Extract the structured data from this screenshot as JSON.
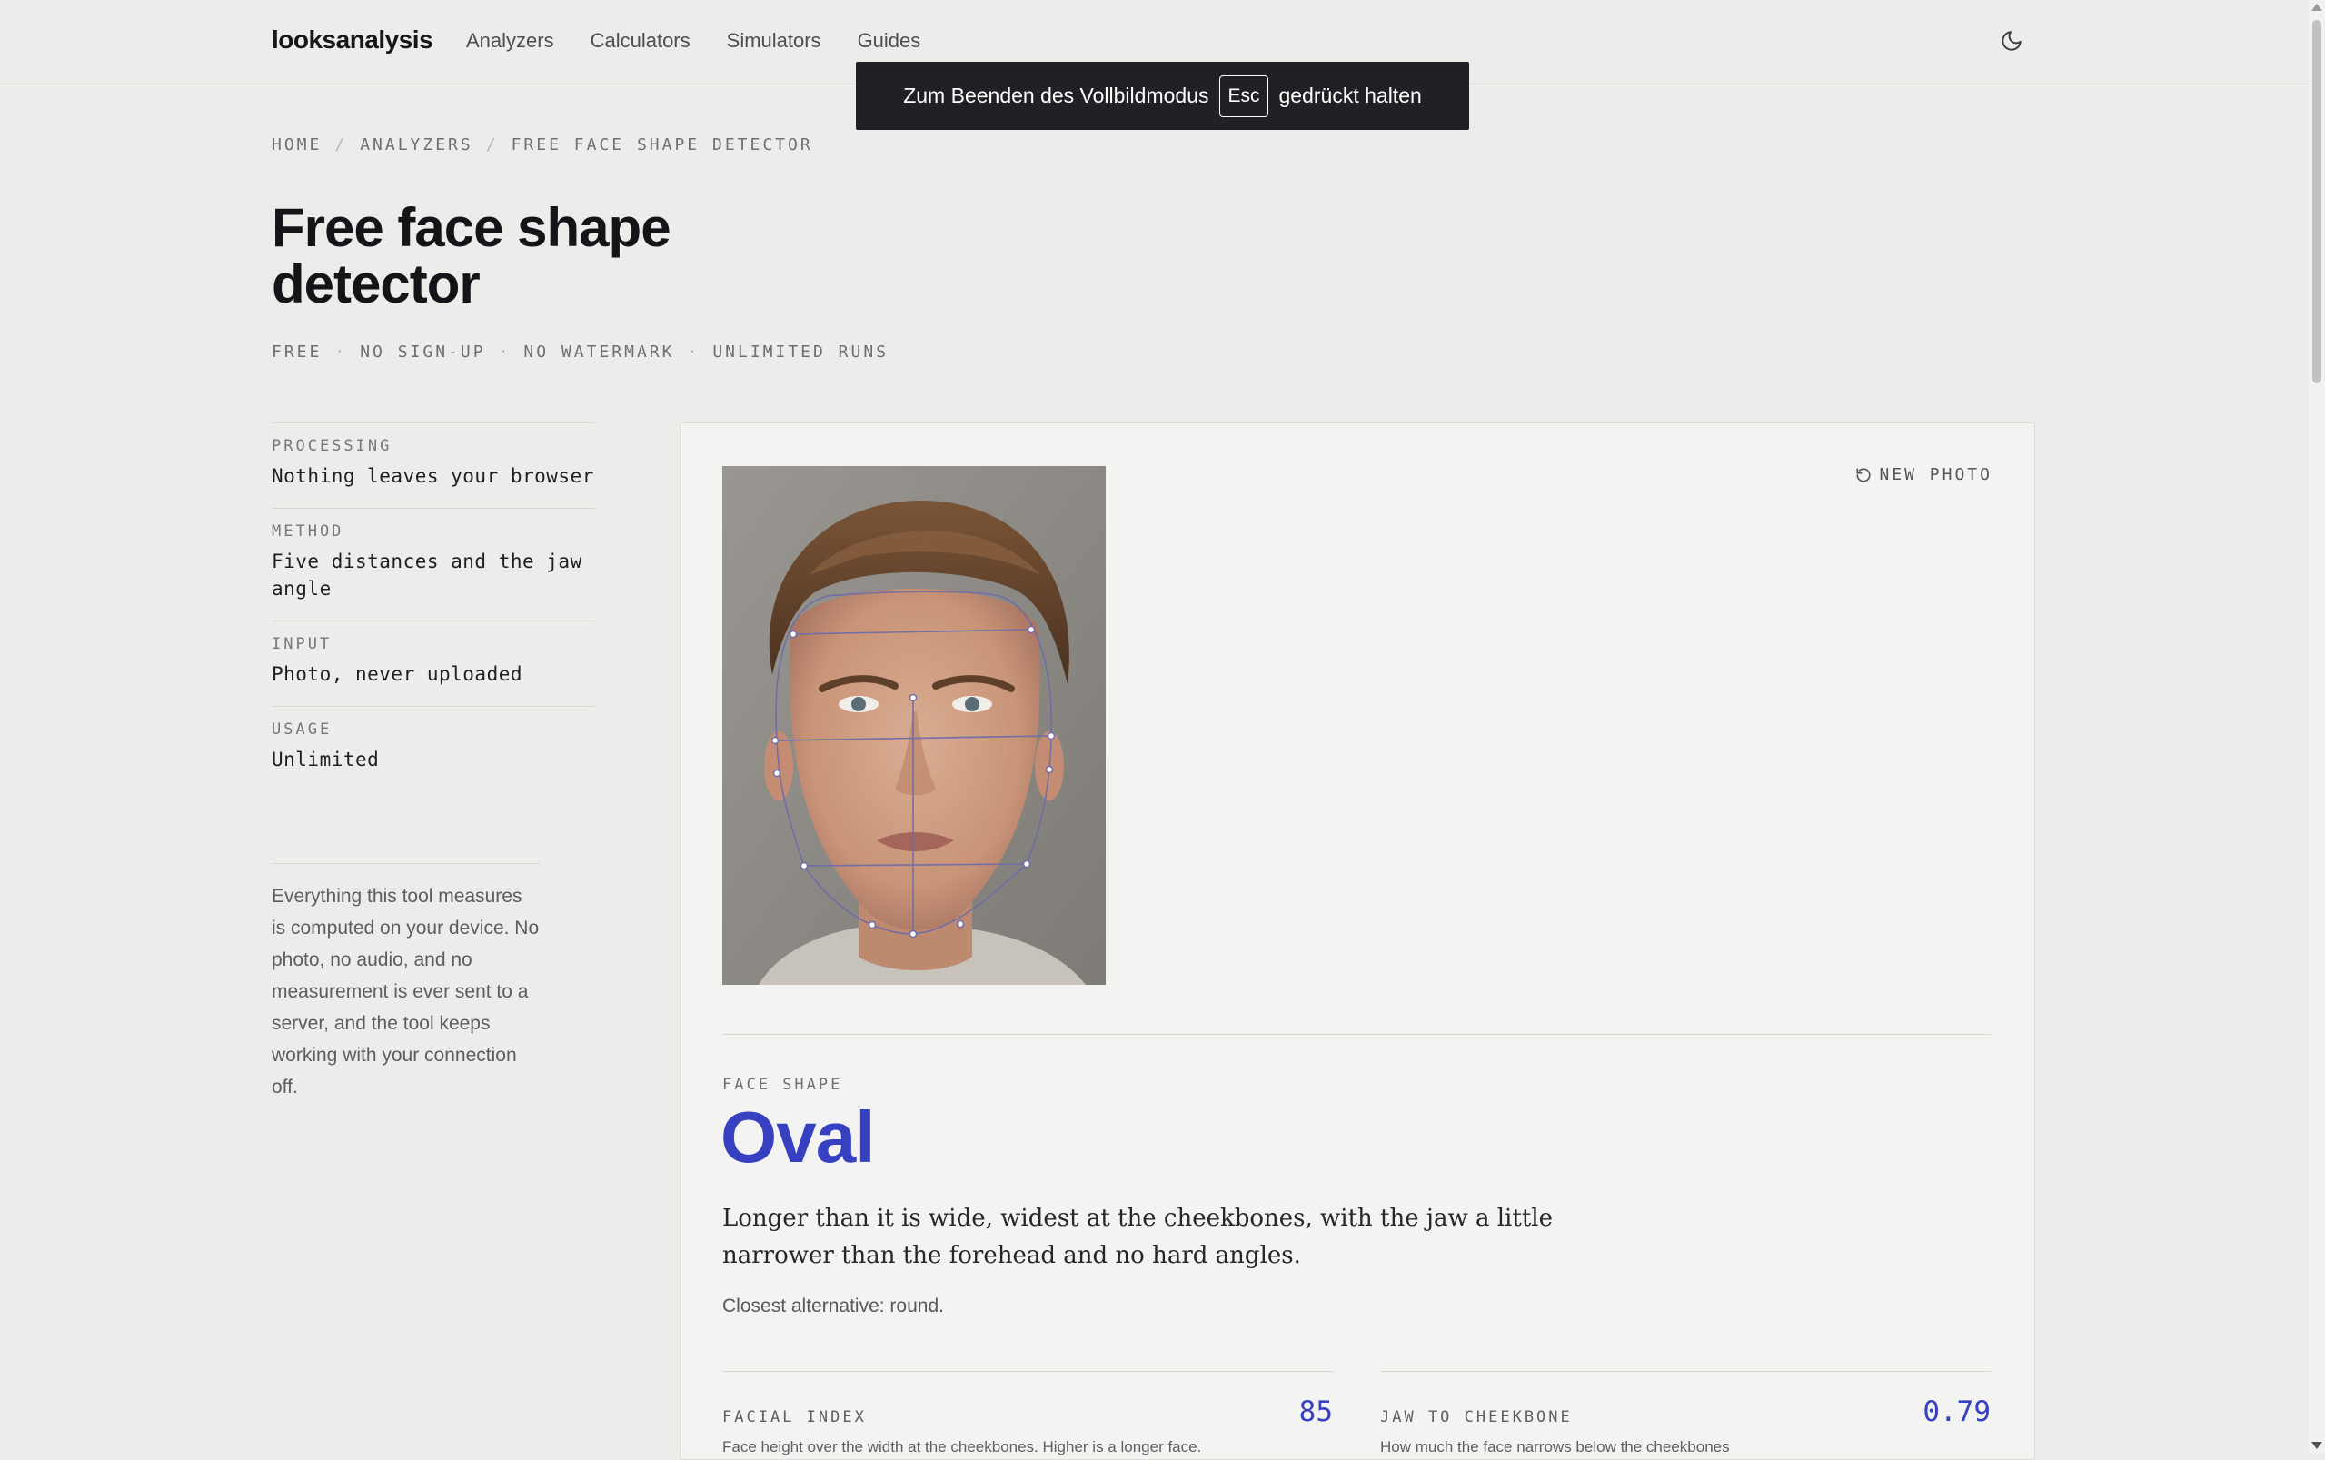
{
  "header": {
    "brand": "looksanalysis",
    "nav": [
      "Analyzers",
      "Calculators",
      "Simulators",
      "Guides"
    ],
    "theme_icon": "moon-icon"
  },
  "fullscreen_notice": {
    "before": "Zum Beenden des Vollbildmodus",
    "key": "Esc",
    "after": "gedrückt halten"
  },
  "breadcrumb": [
    "HOME",
    "ANALYZERS",
    "FREE FACE SHAPE DETECTOR"
  ],
  "page": {
    "title": "Free face shape detector",
    "features": [
      "FREE",
      "NO SIGN-UP",
      "NO WATERMARK",
      "UNLIMITED RUNS"
    ]
  },
  "sidebar": {
    "specs": [
      {
        "label": "PROCESSING",
        "value": "Nothing leaves your browser"
      },
      {
        "label": "METHOD",
        "value": "Five distances and the jaw angle"
      },
      {
        "label": "INPUT",
        "value": "Photo, never uploaded"
      },
      {
        "label": "USAGE",
        "value": "Unlimited"
      }
    ],
    "privacy_note": "Everything this tool measures is computed on your device. No photo, no audio, and no measurement is ever sent to a server, and the tool keeps working with your connection off."
  },
  "tool": {
    "new_photo_label": "NEW PHOTO",
    "new_photo_icon": "refresh-icon",
    "face_shape_label": "FACE SHAPE",
    "face_shape_value": "Oval",
    "description": "Longer than it is wide, widest at the cheekbones, with the jaw a little narrower than the forehead and no hard angles.",
    "alternative": "Closest alternative: round.",
    "metrics": [
      {
        "label": "FACIAL INDEX",
        "value": "85",
        "desc": "Face height over the width at the cheekbones. Higher is a longer face."
      },
      {
        "label": "JAW TO CHEEKBONE",
        "value": "0.79",
        "desc": "How much the face narrows below the cheekbones"
      }
    ]
  },
  "colors": {
    "accent": "#3640c0",
    "background": "#ecedea",
    "card": "#f3f4f1",
    "overlay": "#202124"
  }
}
